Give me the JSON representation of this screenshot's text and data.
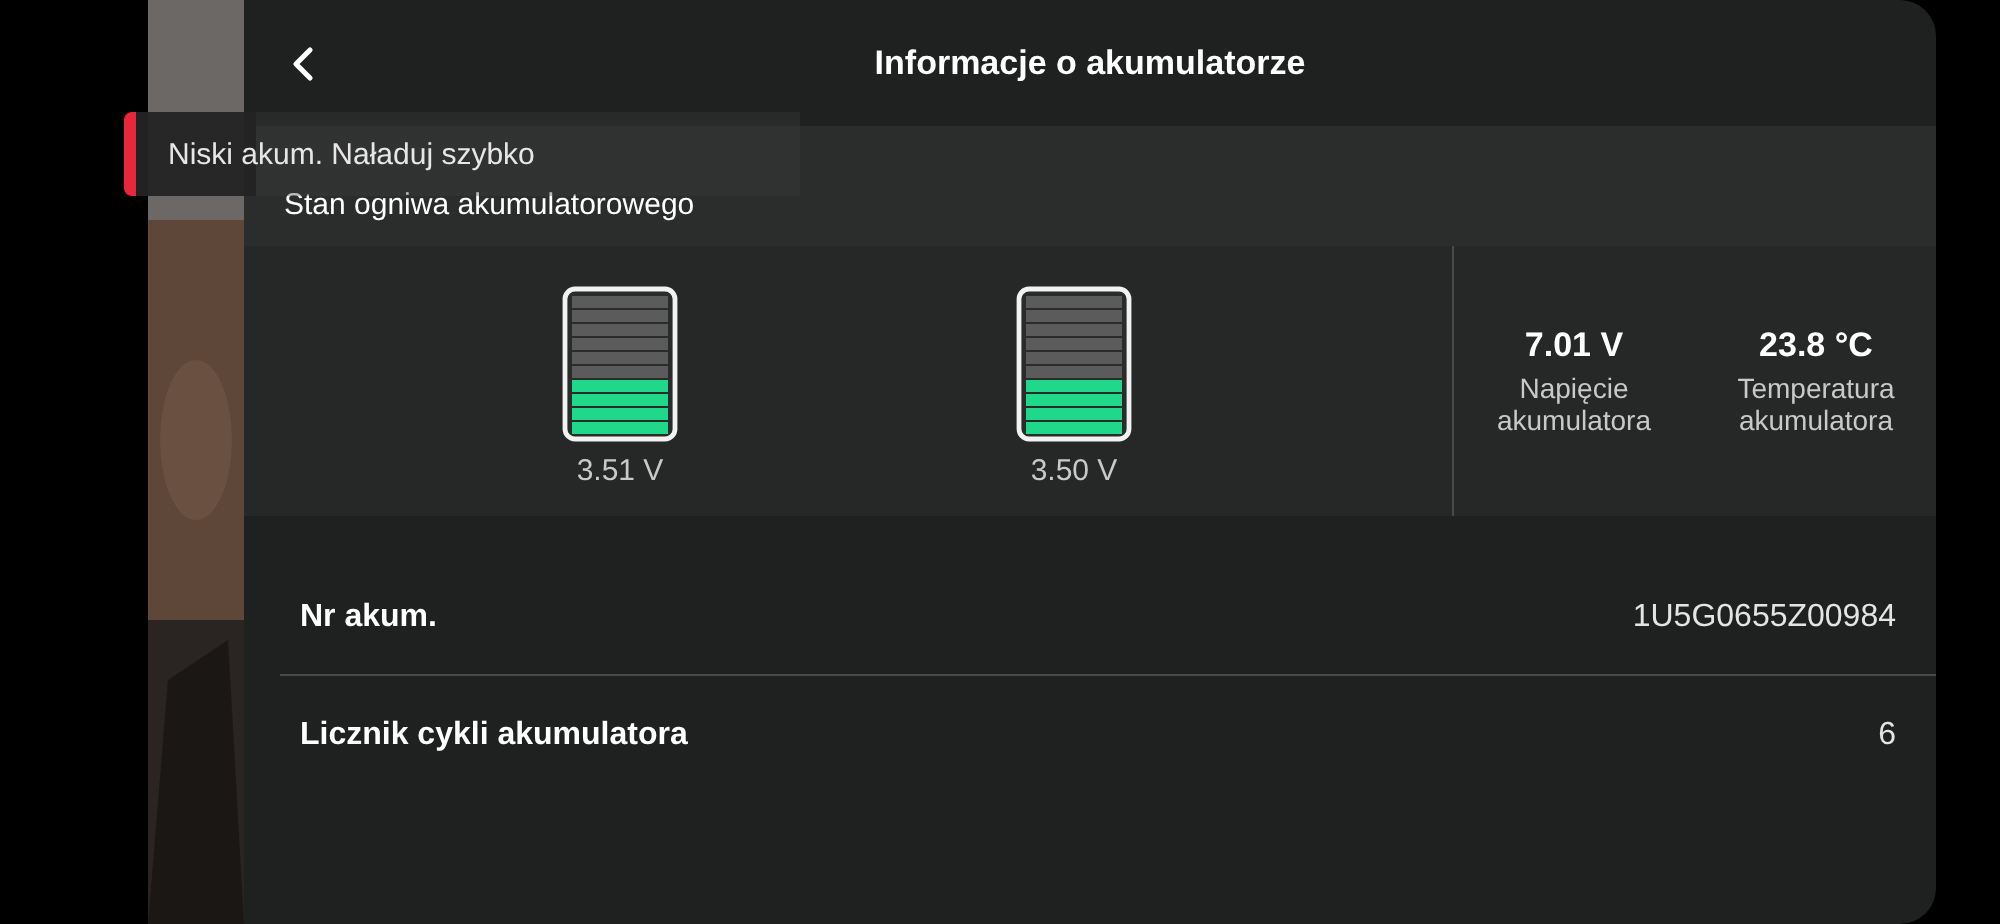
{
  "header": {
    "title": "Informacje o akumulatorze"
  },
  "notification": {
    "text": "Niski akum. Naładuj szybko"
  },
  "section": {
    "title": "Stan ogniwa akumulatorowego"
  },
  "cells": [
    {
      "level": 0.4,
      "voltage": "3.51 V"
    },
    {
      "level": 0.4,
      "voltage": "3.50 V"
    }
  ],
  "stats": [
    {
      "value": "7.01 V",
      "label": "Napięcie akumulatora"
    },
    {
      "value": "23.8 °C",
      "label": "Temperatura akumulatora"
    }
  ],
  "rows": [
    {
      "label": "Nr akum.",
      "value": "1U5G0655Z00984"
    },
    {
      "label": "Licznik cykli akumulatora",
      "value": "6"
    }
  ]
}
